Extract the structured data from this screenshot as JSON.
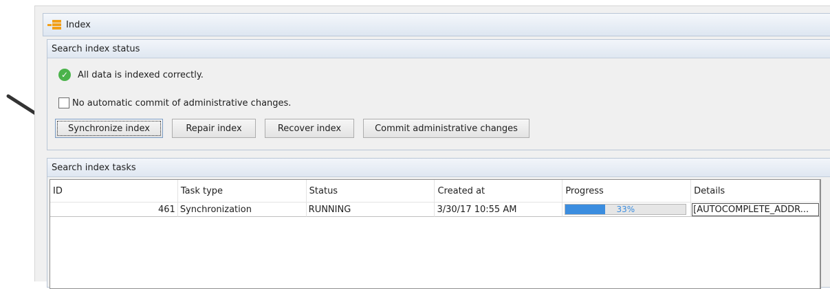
{
  "window": {
    "title": "Index",
    "icon": "index-app-icon"
  },
  "status_group": {
    "header": "Search index status",
    "status_text": "All data is indexed correctly.",
    "status_icon": "check-circle-icon",
    "checkbox_label": "No automatic commit of administrative changes.",
    "checkbox_checked": false,
    "buttons": [
      {
        "label": "Synchronize index",
        "focused": true
      },
      {
        "label": "Repair index"
      },
      {
        "label": "Recover index"
      },
      {
        "label": "Commit administrative changes"
      }
    ]
  },
  "tasks_group": {
    "header": "Search index tasks",
    "columns": [
      "ID",
      "Task type",
      "Status",
      "Created at",
      "Progress",
      "Details"
    ],
    "rows": [
      {
        "id": "461",
        "task_type": "Synchronization",
        "status": "RUNNING",
        "created_at": "3/30/17 10:55 AM",
        "progress": 0.33,
        "progress_label": "33%",
        "details": "[AUTOCOMPLETE_ADDR..."
      }
    ]
  },
  "colors": {
    "accent": "#3b8ddf",
    "ok_green": "#4bb34b",
    "header_gradient": "#dfe7f1"
  }
}
